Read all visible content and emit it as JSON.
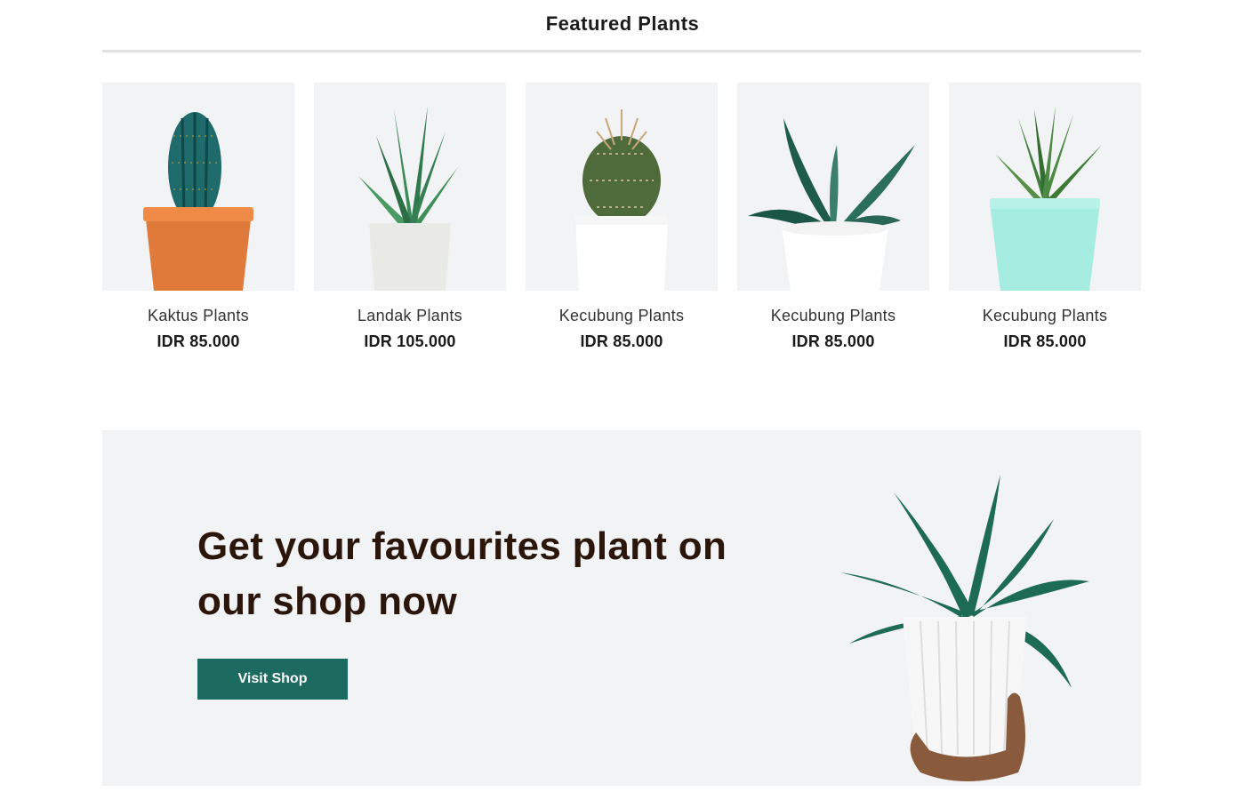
{
  "section": {
    "title": "Featured Plants"
  },
  "products": [
    {
      "name": "Kaktus Plants",
      "price": "IDR 85.000"
    },
    {
      "name": "Landak Plants",
      "price": "IDR 105.000"
    },
    {
      "name": "Kecubung Plants",
      "price": "IDR 85.000"
    },
    {
      "name": "Kecubung Plants",
      "price": "IDR 85.000"
    },
    {
      "name": "Kecubung Plants",
      "price": "IDR 85.000"
    }
  ],
  "promo": {
    "heading": "Get your favourites plant on our shop now",
    "button_label": "Visit Shop"
  },
  "colors": {
    "accent": "#1d6b60",
    "heading": "#2a160b",
    "card_bg": "#f2f3f5"
  }
}
